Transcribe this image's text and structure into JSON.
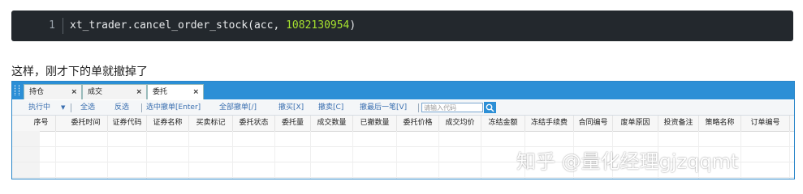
{
  "code": {
    "line_number": "1",
    "prefix": "xt_trader.cancel_order_stock(acc, ",
    "number": "1082130954",
    "suffix": ")"
  },
  "caption": "这样，刚才下的单就撤掉了",
  "tabs": [
    {
      "label": "持仓",
      "close": "×"
    },
    {
      "label": "成交",
      "close": "×"
    },
    {
      "label": "委托",
      "close": "×"
    }
  ],
  "toolbar": {
    "executing": "执行中",
    "dropdown": "▼",
    "select_all": "全选",
    "invert": "反选",
    "cancel_selected": "选中撤单[Enter]",
    "cancel_all": "全部撤单[/]",
    "cancel_buy": "撤买[X]",
    "cancel_sell": "撤卖[C]",
    "cancel_last": "撤最后一笔[V]",
    "search_placeholder": "请输入代码"
  },
  "columns": [
    "序号",
    "委托时间",
    "证券代码",
    "证券名称",
    "买卖标记",
    "委托状态",
    "委托量",
    "成交数量",
    "已撤数量",
    "委托价格",
    "成交均价",
    "冻结金额",
    "冻结手续费",
    "合同编号",
    "废单原因",
    "投资备注",
    "策略名称",
    "订单编号"
  ],
  "watermark": "知乎 @量化经理gjzqqmt"
}
